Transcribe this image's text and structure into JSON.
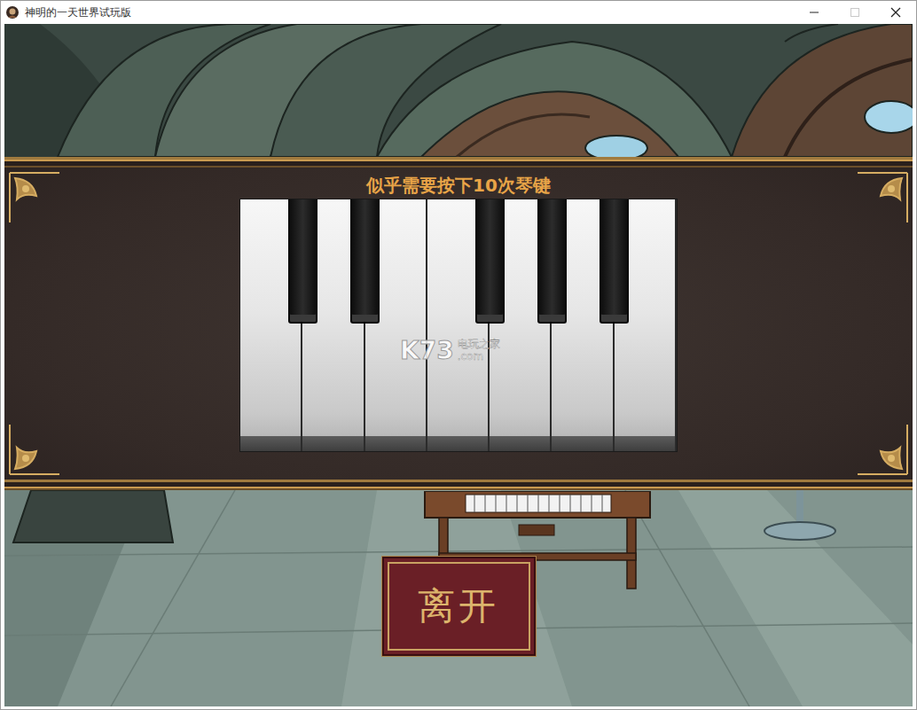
{
  "window": {
    "title": "神明的一天世界试玩版"
  },
  "dialog": {
    "prompt": "似乎需要按下10次琴键",
    "piano": {
      "white_keys": [
        {
          "pressed": false
        },
        {
          "pressed": false
        },
        {
          "pressed": false
        },
        {
          "pressed": false
        },
        {
          "pressed": false
        },
        {
          "pressed": false
        },
        {
          "pressed": false
        }
      ],
      "black_keys": [
        {
          "after_white": 1
        },
        {
          "after_white": 2
        },
        {
          "after_white": 4
        },
        {
          "after_white": 5
        },
        {
          "after_white": 6
        }
      ]
    }
  },
  "watermark": {
    "logo": "K73",
    "name": "电玩之家",
    "domain": ".com"
  },
  "leave_button": {
    "label": "离开"
  }
}
